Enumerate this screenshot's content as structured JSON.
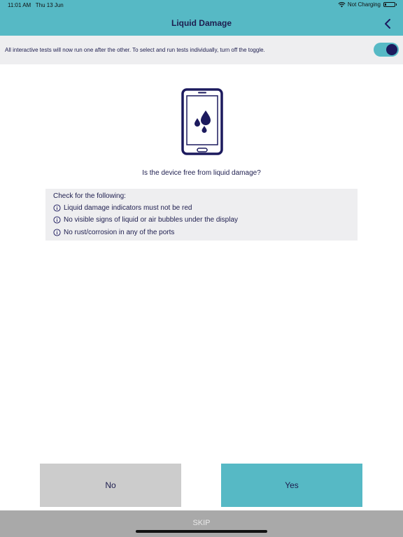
{
  "status_bar": {
    "time": "11:01 AM   Thu 13 Jun",
    "charging_status": "Not Charging"
  },
  "header": {
    "title": "Liquid Damage",
    "back_icon": "chevron-left-icon"
  },
  "banner": {
    "text": "All interactive tests will now run one after the other. To select and run tests individually, turn off the toggle.",
    "toggle_on": true
  },
  "main": {
    "illustration_icon": "phone-liquid-drops-icon",
    "question": "Is the device free from liquid damage?",
    "checklist": {
      "heading": "Check for the following:",
      "items": [
        {
          "icon": "info-icon",
          "label": "Liquid damage indicators must not be red"
        },
        {
          "icon": "info-icon",
          "label": "No visible signs of liquid or air bubbles under the display"
        },
        {
          "icon": "info-icon",
          "label": "No rust/corrosion in any of the ports"
        }
      ]
    }
  },
  "actions": {
    "no_label": "No",
    "yes_label": "Yes",
    "skip_label": "SKIP"
  },
  "colors": {
    "accent": "#56b9c5",
    "navy": "#1c1a5e",
    "panel": "#eeeef0",
    "no_button": "#cccccc",
    "skip_bar": "#a9a9a9"
  }
}
